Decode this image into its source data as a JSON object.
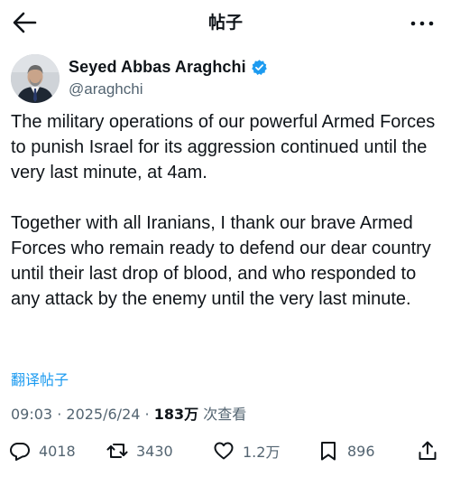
{
  "header": {
    "title": "帖子",
    "back_icon": "arrow-left-icon",
    "more_icon": "more-horizontal-icon"
  },
  "author": {
    "name": "Seyed Abbas Araghchi",
    "handle": "@araghchi",
    "verified_color": "#1d9bf0"
  },
  "post": {
    "paragraphs": [
      "The military operations of our powerful Armed Forces to punish Israel for its aggression continued until the very last minute, at 4am.",
      "Together with all Iranians, I thank our brave Armed Forces who remain ready to defend our dear country until their last drop of blood, and who responded to any attack by the enemy until the very last minute."
    ],
    "translate_label": "翻译帖子",
    "time": "09:03",
    "date": "2025/6/24",
    "views": "183万",
    "views_label": "次查看"
  },
  "actions": {
    "reply_count": "4018",
    "retweet_count": "3430",
    "like_count": "1.2万",
    "bookmark_count": "896"
  },
  "colors": {
    "text": "#0f1419",
    "secondary": "#536471",
    "link": "#1d9bf0"
  }
}
